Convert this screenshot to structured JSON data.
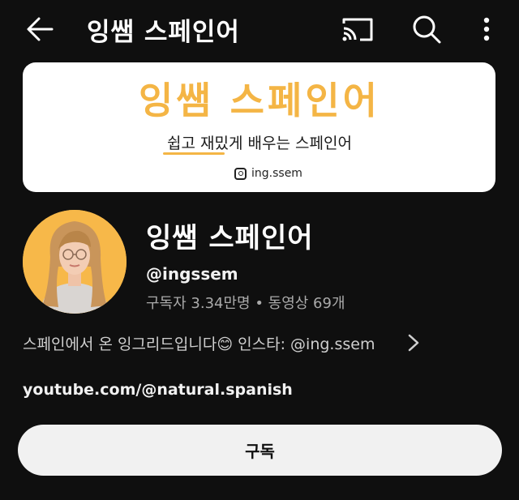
{
  "topbar": {
    "title": "잉쌤 스페인어",
    "icons": [
      "back-arrow-icon",
      "cast-icon",
      "search-icon",
      "more-vert-icon"
    ]
  },
  "banner": {
    "title": "잉쌤 스페인어",
    "subtitle": "쉽고 재밌게 배우는 스페인어",
    "instagram": "ing.ssem",
    "accent_color": "#f4b545"
  },
  "channel": {
    "name": "잉쌤 스페인어",
    "handle": "@ingssem",
    "stats": "구독자 3.34만명 • 동영상 69개",
    "description": "스페인에서 온 잉그리드입니다😊 인스타: @ing.ssem",
    "link": "youtube.com/@natural.spanish"
  },
  "subscribe": {
    "label": "구독"
  }
}
